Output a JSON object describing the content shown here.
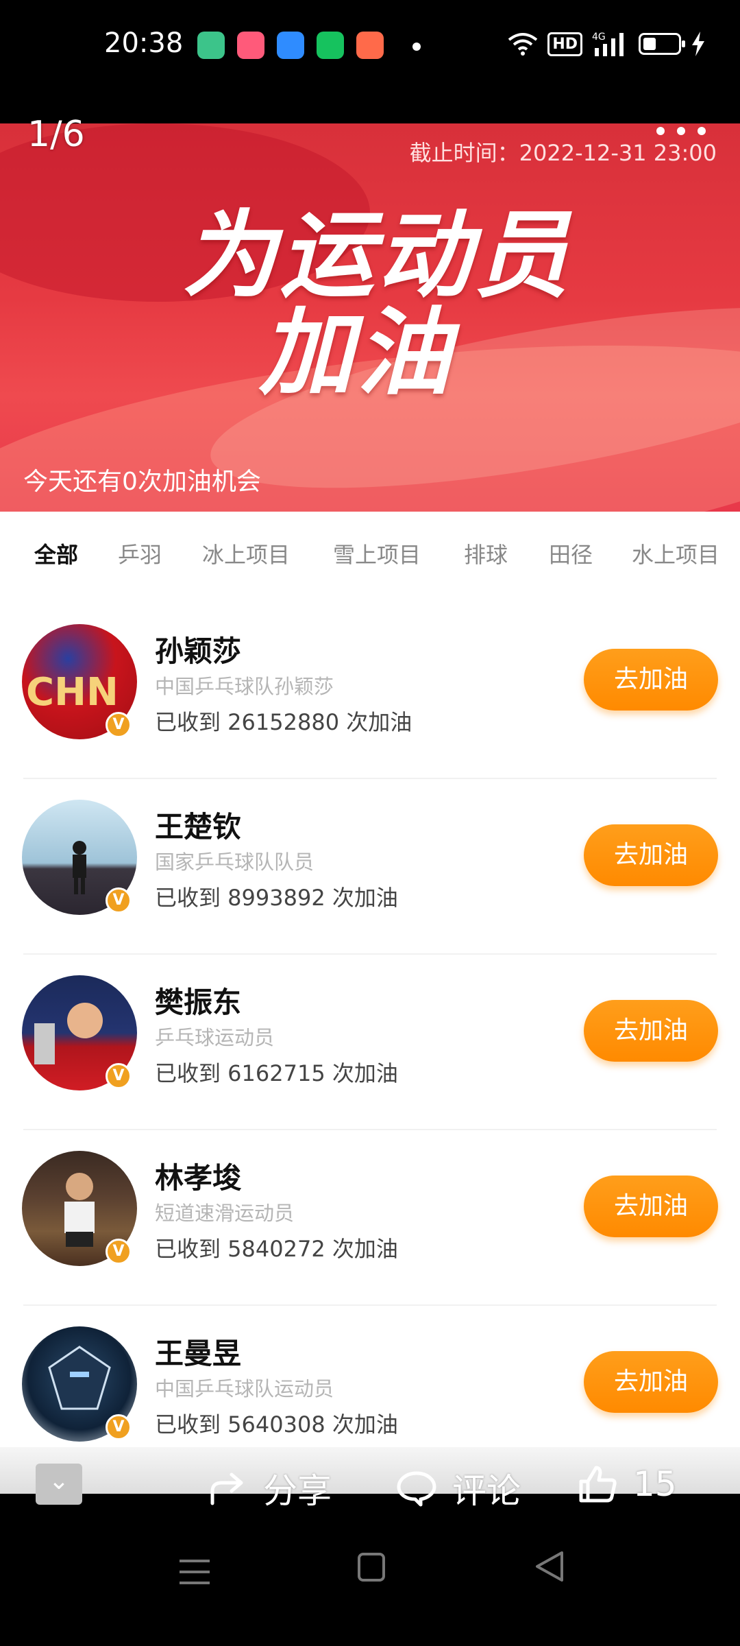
{
  "status_bar": {
    "time": "20:38",
    "hd": "HD",
    "network": "4G",
    "notification_icons": [
      "phone-icon",
      "app-grid-icon",
      "browser-icon",
      "shop-icon",
      "game-icon"
    ]
  },
  "viewer": {
    "counter": "1/6",
    "deadline": "截止时间：2022-12-31 23:00",
    "headline_line1": "为运动员",
    "headline_line2": "加油",
    "chances": "今天还有0次加油机会"
  },
  "tabs": [
    "全部",
    "乒羽",
    "冰上项目",
    "雪上项目",
    "排球",
    "田径",
    "水上项目"
  ],
  "active_tab": "全部",
  "athletes": [
    {
      "name": "孙颖莎",
      "desc": "中国乒乓球队孙颖莎",
      "count": "已收到  26152880  次加油",
      "button": "去加油",
      "badge": "V"
    },
    {
      "name": "王楚钦",
      "desc": "国家乒乓球队队员",
      "count": "已收到  8993892  次加油",
      "button": "去加油",
      "badge": "V"
    },
    {
      "name": "樊振东",
      "desc": "乒乓球运动员",
      "count": "已收到  6162715  次加油",
      "button": "去加油",
      "badge": "V"
    },
    {
      "name": "林孝埈",
      "desc": "短道速滑运动员",
      "count": "已收到  5840272  次加油",
      "button": "去加油",
      "badge": "V"
    },
    {
      "name": "王曼昱",
      "desc": "中国乒乓球队运动员",
      "count": "已收到  5640308  次加油",
      "button": "去加油",
      "badge": "V"
    }
  ],
  "bottom_actions": {
    "share": "分享",
    "comment": "评论",
    "like_count": "15",
    "collapse": "⌄"
  },
  "colors": {
    "banner_red": "#e63a42",
    "cheer_orange": "#ff8a00",
    "badge_gold": "#f0a020"
  }
}
